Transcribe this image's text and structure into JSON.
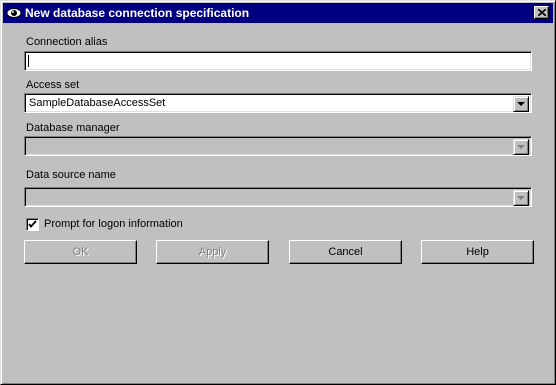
{
  "window": {
    "title": "New database connection specification"
  },
  "fields": {
    "alias": {
      "label": "Connection alias",
      "value": ""
    },
    "access_set": {
      "label": "Access set",
      "value": "SampleDatabaseAccessSet"
    },
    "db_manager": {
      "label": "Database manager",
      "value": ""
    },
    "data_source": {
      "label": "Data source name",
      "value": ""
    }
  },
  "prompt_logon": {
    "label": "Prompt for logon information",
    "checked": true
  },
  "buttons": {
    "ok": "OK",
    "apply": "Apply",
    "cancel": "Cancel",
    "help": "Help"
  }
}
